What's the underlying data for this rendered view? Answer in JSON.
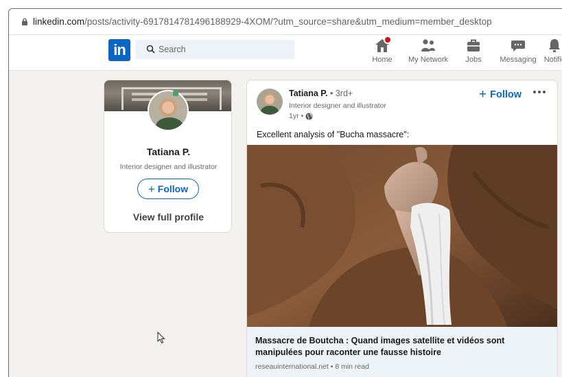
{
  "browser": {
    "url_host": "linkedin.com",
    "url_path": "/posts/activity-6917814781496188929-4XOM/?utm_source=share&utm_medium=member_desktop"
  },
  "nav": {
    "logo": "in",
    "search_placeholder": "Search",
    "items": [
      {
        "label": "Home",
        "icon": "home-icon",
        "badge": true
      },
      {
        "label": "My Network",
        "icon": "network-icon"
      },
      {
        "label": "Jobs",
        "icon": "briefcase-icon"
      },
      {
        "label": "Messaging",
        "icon": "message-icon"
      },
      {
        "label": "Notific",
        "icon": "bell-icon"
      }
    ]
  },
  "profile": {
    "name": "Tatiana P.",
    "headline": "Interior designer and illustrator",
    "follow_label": "Follow",
    "view_profile_label": "View full profile"
  },
  "post": {
    "author": "Tatiana P.",
    "degree": "• 3rd+",
    "headline": "Interior designer and illustrator",
    "time": "1yr •",
    "follow_label": "Follow",
    "text": "Excellent analysis of \"Bucha massacre\":",
    "article_title": "Massacre de Boutcha : Quand images satellite et vidéos sont manipulées pour raconter une fausse histoire",
    "article_meta": "reseauinternational.net • 8 min read"
  },
  "colors": {
    "brand": "#0a66c2",
    "badge": "#cc1016",
    "background": "#f3f2ef"
  }
}
